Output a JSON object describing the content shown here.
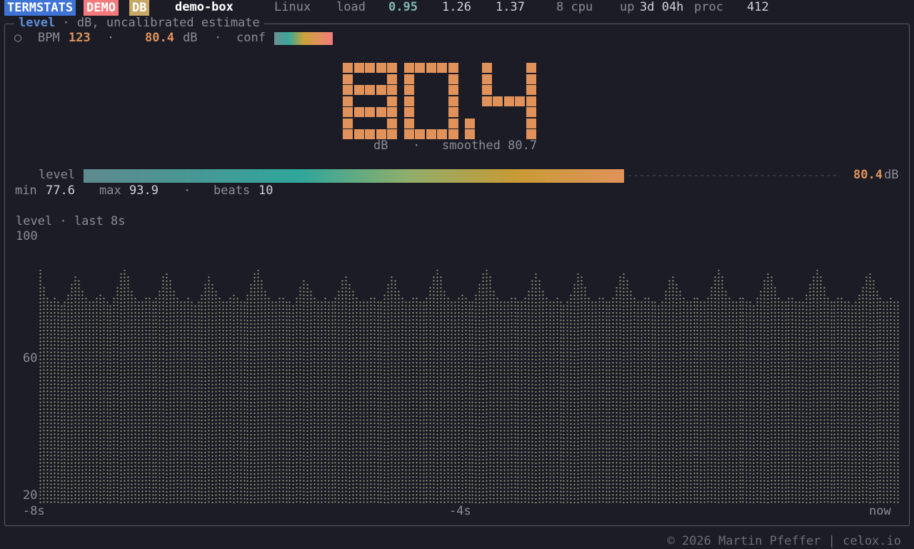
{
  "topbar": {
    "badge_app": "TERMSTATS",
    "badge_demo": "DEMO",
    "badge_db": "DB",
    "hostname": "demo-box",
    "os": "Linux",
    "load_label": "load",
    "load_1": "0.95",
    "load_5": "1.26",
    "load_15": "1.37",
    "cpu": "8 cpu",
    "up_label": "up",
    "uptime": "3d 04h",
    "proc_label": "proc",
    "proc_count": "412"
  },
  "panel": {
    "title": "level",
    "subtitle": " · dB, uncalibrated estimate",
    "circle_icon": "○",
    "bpm_label": "BPM",
    "bpm_value": "123",
    "sep": "·",
    "db_value": "80.4",
    "db_unit": "dB",
    "conf_label": "conf",
    "big_value": "80.4",
    "big_caption_unit": "dB",
    "big_caption_sep": "·",
    "big_caption_smoothed": "smoothed 80.7",
    "level_label": "level",
    "level_value": "80.4",
    "level_unit": "dB",
    "level_fraction": 0.715,
    "min_label": "min",
    "min_value": "77.6",
    "max_label": "max",
    "max_value": "93.9",
    "beats_label": "beats",
    "beats_value": "10"
  },
  "chart_data": {
    "type": "area",
    "title": "level · last 8s",
    "ylim": [
      20,
      100
    ],
    "yticks": [
      "100",
      "60",
      "20"
    ],
    "xticks": [
      "-8s",
      "-4s",
      "now"
    ],
    "values": [
      90,
      85,
      82,
      81,
      82,
      81,
      80,
      81,
      83,
      86,
      88,
      87,
      84,
      82,
      81,
      81,
      82,
      83,
      82,
      81,
      80,
      82,
      85,
      89,
      90,
      88,
      84,
      82,
      81,
      81,
      82,
      82,
      81,
      82,
      84,
      88,
      89,
      87,
      84,
      82,
      81,
      81,
      82,
      81,
      80,
      81,
      83,
      86,
      88,
      86,
      84,
      82,
      81,
      81,
      82,
      83,
      82,
      81,
      81,
      83,
      86,
      89,
      90,
      87,
      84,
      82,
      81,
      81,
      82,
      82,
      81,
      81,
      80,
      82,
      85,
      87,
      86,
      84,
      82,
      81,
      81,
      82,
      81,
      81,
      82,
      84,
      87,
      88,
      86,
      84,
      82,
      81,
      81,
      81,
      82,
      82,
      81,
      81,
      83,
      86,
      88,
      87,
      84,
      82,
      81,
      81,
      82,
      82,
      81,
      81,
      82,
      85,
      88,
      90,
      88,
      84,
      82,
      81,
      81,
      82,
      83,
      82,
      81,
      81,
      83,
      86,
      89,
      90,
      88,
      84,
      82,
      81,
      81,
      81,
      82,
      82,
      81,
      81,
      82,
      84,
      87,
      89,
      87,
      84,
      82,
      81,
      81,
      82,
      81,
      80,
      81,
      83,
      86,
      89,
      88,
      85,
      82,
      81,
      81,
      82,
      82,
      81,
      81,
      82,
      85,
      88,
      89,
      87,
      84,
      82,
      81,
      81,
      82,
      82,
      81,
      81,
      80,
      81,
      84,
      87,
      88,
      86,
      84,
      82,
      81,
      81,
      82,
      82,
      81,
      81,
      82,
      85,
      88,
      90,
      88,
      84,
      82,
      81,
      81,
      82,
      82,
      81,
      81,
      80,
      82,
      84,
      87,
      89,
      88,
      85,
      82,
      81,
      81,
      82,
      82,
      81,
      81,
      81,
      83,
      86,
      88,
      90,
      88,
      85,
      82,
      81,
      81,
      82,
      82,
      81,
      81,
      80,
      81,
      83,
      85,
      88,
      89,
      87,
      84,
      82,
      81,
      81,
      82,
      81,
      81
    ]
  },
  "footer": "© 2026 Martin Pfeffer | celox.io",
  "colors": {
    "accent_blue": "#3f73d6",
    "accent_red": "#f27a7d",
    "accent_gold": "#c8a865",
    "value_orange": "#e0925a",
    "value_teal": "#7fb8b2"
  }
}
